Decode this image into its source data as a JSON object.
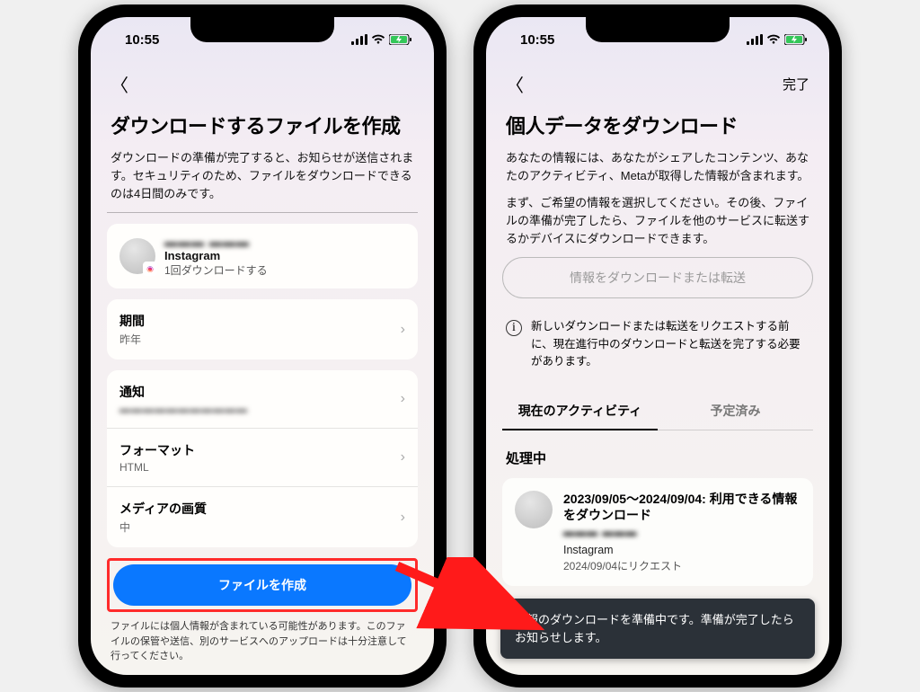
{
  "status": {
    "time": "10:55"
  },
  "left": {
    "title": "ダウンロードするファイルを作成",
    "description": "ダウンロードの準備が完了すると、お知らせが送信されます。セキュリティのため、ファイルをダウンロードできるのは4日間のみです。",
    "account": {
      "name_obscured": "▬▬▬ ▬▬▬",
      "platform": "Instagram",
      "download_note": "1回ダウンロードする"
    },
    "rows": {
      "period": {
        "label": "期間",
        "value": "昨年"
      },
      "notify": {
        "label": "通知",
        "value": "▬▬▬▬▬▬▬▬▬▬▬"
      },
      "format": {
        "label": "フォーマット",
        "value": "HTML"
      },
      "quality": {
        "label": "メディアの画質",
        "value": "中"
      }
    },
    "button": "ファイルを作成",
    "fine_print": "ファイルには個人情報が含まれている可能性があります。このファイルの保管や送信、別のサービスへのアップロードは十分注意して行ってください。"
  },
  "right": {
    "done": "完了",
    "title": "個人データをダウンロード",
    "desc1": "あなたの情報には、あなたがシェアしたコンテンツ、あなたのアクティビティ、Metaが取得した情報が含まれます。",
    "desc2": "まず、ご希望の情報を選択してください。その後、ファイルの準備が完了したら、ファイルを他のサービスに転送するかデバイスにダウンロードできます。",
    "disabled_button": "情報をダウンロードまたは転送",
    "info_note": "新しいダウンロードまたは転送をリクエストする前に、現在進行中のダウンロードと転送を完了する必要があります。",
    "tabs": {
      "current": "現在のアクティビティ",
      "scheduled": "予定済み"
    },
    "section": "処理中",
    "activity": {
      "title": "2023/09/05～2024/09/04: 利用できる情報をダウンロード",
      "name_obscured": "▬▬▬ ▬▬▬",
      "platform": "Instagram",
      "requested": "2024/09/04にリクエスト"
    },
    "toast": "情報のダウンロードを準備中です。準備が完了したらお知らせします。"
  }
}
